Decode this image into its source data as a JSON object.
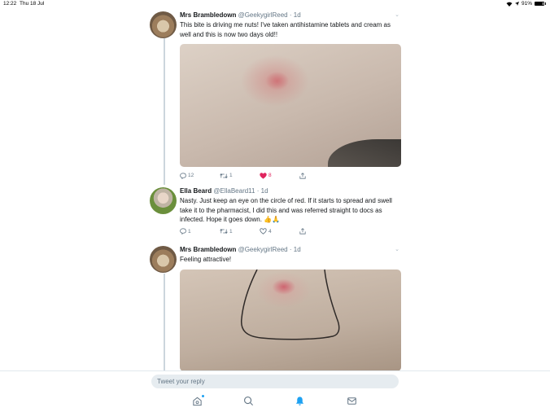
{
  "status_bar": {
    "time": "12:22",
    "date": "Thu 18 Jul",
    "battery": "91%"
  },
  "tweets": [
    {
      "name": "Mrs Brambledown",
      "handle": "@GeekygirlReed",
      "age": "· 1d",
      "text": "This bite is driving me nuts! I've taken antihistamine tablets and cream as well and this is now two days old!!",
      "replies": "12",
      "retweets": "1",
      "likes": "8",
      "liked": true
    },
    {
      "name": "Ella Beard",
      "handle": "@EllaBeard11",
      "age": "· 1d",
      "text": "Nasty. Just keep an eye on the circle of red. If it starts to spread and swell take it to the pharmacist, I did this and was referred straight to docs as infected. Hope it goes down. 👍🙏",
      "replies": "1",
      "retweets": "1",
      "likes": "4",
      "liked": false
    },
    {
      "name": "Mrs Brambledown",
      "handle": "@GeekygirlReed",
      "age": "· 1d",
      "text": "Feeling attractive!"
    }
  ],
  "reply": {
    "placeholder": "Tweet your reply"
  },
  "tabbar": {
    "icons": [
      "home-icon",
      "search-icon",
      "notifications-icon",
      "messages-icon"
    ],
    "active": "notifications-icon"
  },
  "colors": {
    "accent": "#1da1f2",
    "like": "#e0245e",
    "muted": "#657786"
  }
}
